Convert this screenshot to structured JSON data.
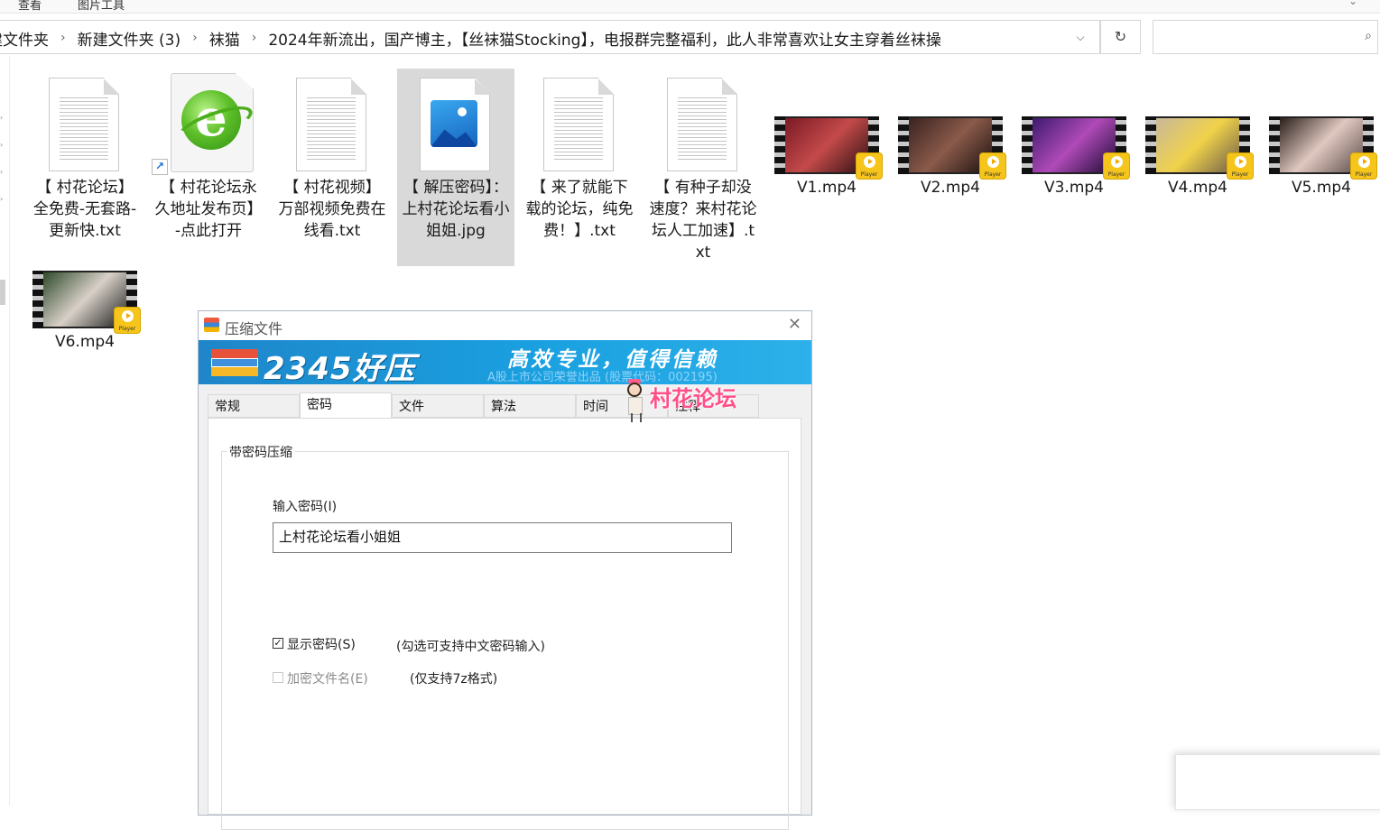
{
  "ribbon": {
    "tab_view": "查看",
    "tab_picture_tools": "图片工具"
  },
  "address": {
    "crumbs": [
      "建文件夹",
      "新建文件夹 (3)",
      "袜猫",
      "2024年新流出，国产博主，【丝袜猫Stocking】，电报群完整福利，此人非常喜欢让女主穿着丝袜操"
    ],
    "separator": "›"
  },
  "search": {
    "placeholder": ""
  },
  "files": [
    {
      "name": "【 村花论坛】全免费-无套路-更新快.txt",
      "type": "txt"
    },
    {
      "name": "【 村花论坛永久地址发布页】-点此打开",
      "type": "url"
    },
    {
      "name": "【 村花视频】万部视频免费在线看.txt",
      "type": "txt"
    },
    {
      "name": "【 解压密码】：上村花论坛看小姐姐.jpg",
      "type": "jpg",
      "selected": true
    },
    {
      "name": "【 来了就能下载的论坛，纯免费！】.txt",
      "type": "txt"
    },
    {
      "name": "【 有种子却没速度？来村花论坛人工加速】.txt",
      "type": "txt"
    }
  ],
  "videos": [
    {
      "name": "V1.mp4",
      "colors": [
        "#7a1a24",
        "#c44a4a",
        "#2a0f12"
      ]
    },
    {
      "name": "V2.mp4",
      "colors": [
        "#3a2320",
        "#8a5a4a",
        "#1a100e"
      ]
    },
    {
      "name": "V3.mp4",
      "colors": [
        "#3d1a6e",
        "#b04ab8",
        "#1a0b33"
      ]
    },
    {
      "name": "V4.mp4",
      "colors": [
        "#c8b89a",
        "#f1d24a",
        "#6a5a4a"
      ]
    },
    {
      "name": "V5.mp4",
      "colors": [
        "#2a1e1a",
        "#e0c8c0",
        "#5a4a48"
      ]
    },
    {
      "name": "V6.mp4",
      "colors": [
        "#2e4a2a",
        "#d8d0c8",
        "#1a1a1a"
      ]
    }
  ],
  "player_badge": "Player",
  "dialog": {
    "title": "压缩文件",
    "banner_brand": "2345好压",
    "banner_slogan": "高效专业，值得信赖",
    "banner_sub": "A股上市公司荣誉出品 (股票代码：002195)",
    "tabs": [
      "常规",
      "密码",
      "文件",
      "算法",
      "时间",
      "注释"
    ],
    "active_tab": "密码",
    "group_title": "带密码压缩",
    "password_label": "输入密码(I)",
    "password_value": "上村花论坛看小姐姐",
    "show_password": {
      "label": "显示密码(S)",
      "checked": true,
      "note": "(勾选可支持中文密码输入)"
    },
    "encrypt_names": {
      "label": "加密文件名(E)",
      "checked": false,
      "note": "(仅支持7z格式)"
    }
  },
  "watermark": "村花论坛",
  "colors": {
    "selection": "#d9d9d9",
    "banner": "#1aa0e0",
    "watermark": "#ff4f88"
  }
}
